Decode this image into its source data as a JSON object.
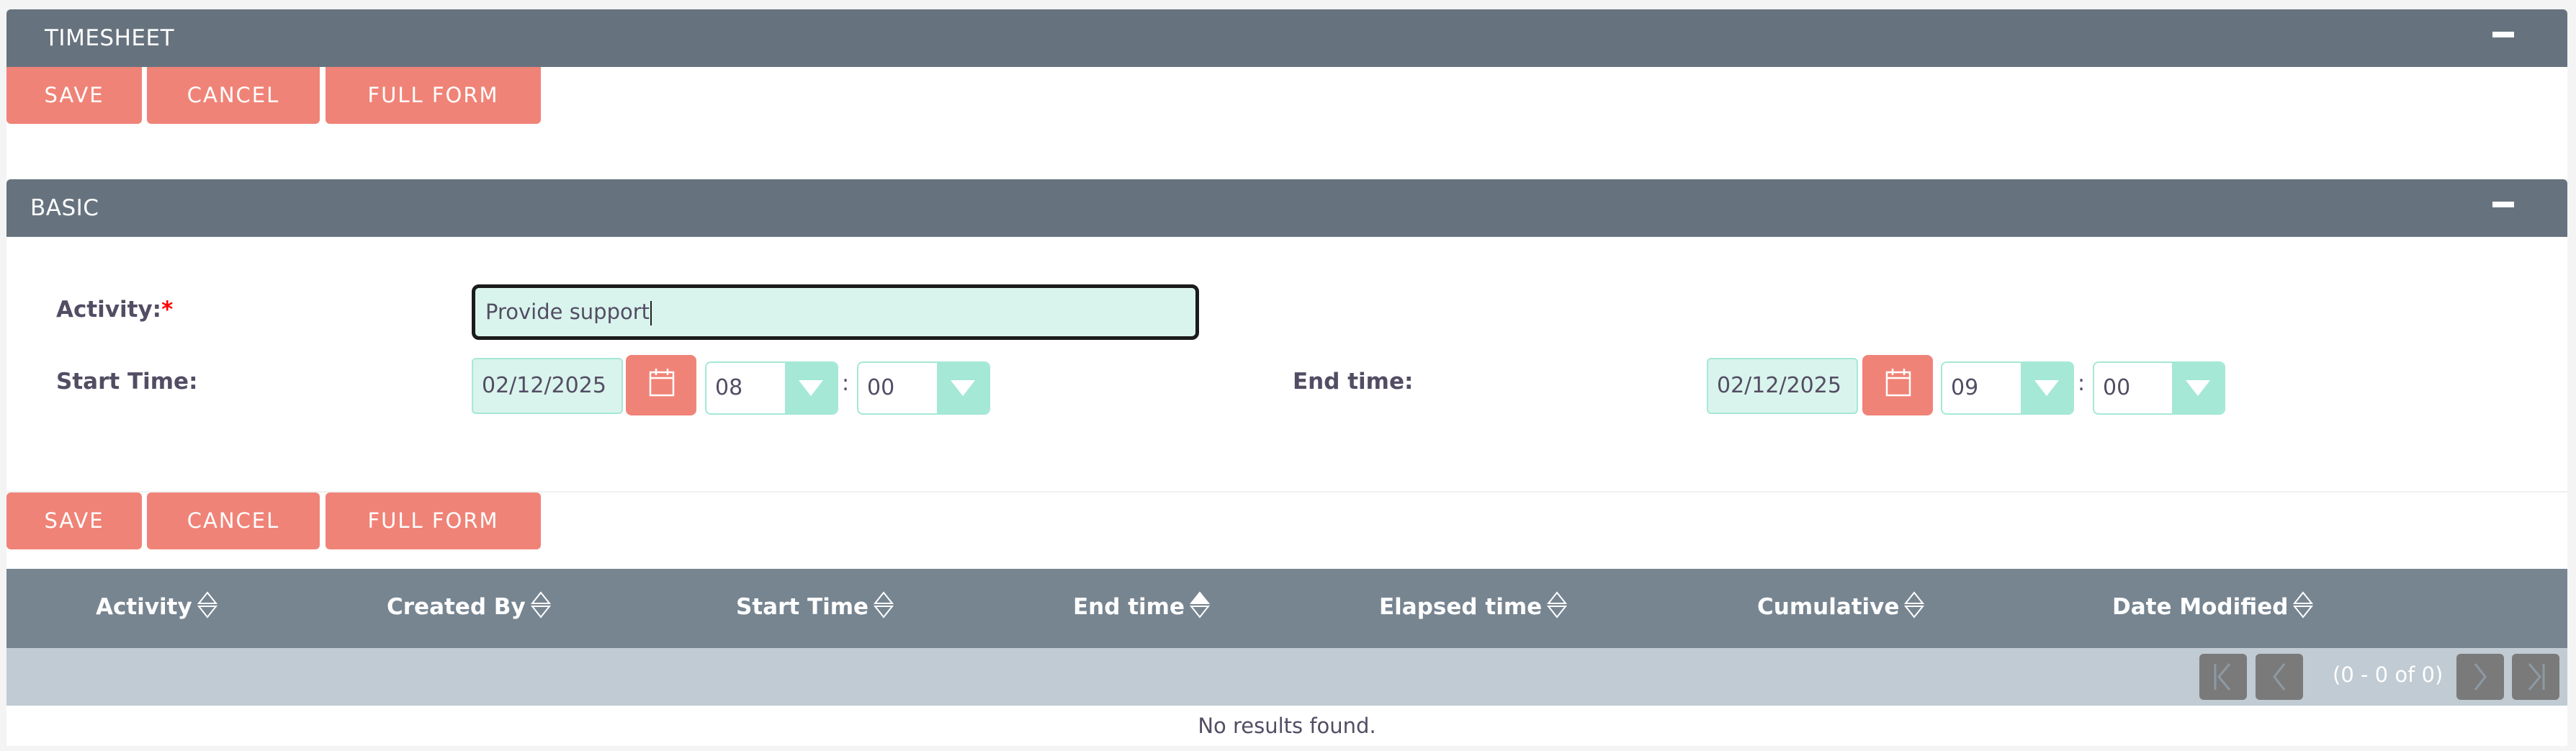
{
  "timesheet_header": {
    "title": "TIMESHEET",
    "collapse_icon": "minus-icon"
  },
  "top_buttons": {
    "save": "SAVE",
    "cancel": "CANCEL",
    "full_form": "FULL FORM"
  },
  "basic_header": {
    "title": "BASIC",
    "collapse_icon": "minus-icon"
  },
  "form": {
    "activity": {
      "label": "Activity:",
      "required_mark": "*",
      "value": "Provide support"
    },
    "start_time": {
      "label": "Start Time:",
      "date": "02/12/2025",
      "hour": "08",
      "minute": "00",
      "separator": ":"
    },
    "end_time": {
      "label": "End time:",
      "date": "02/12/2025",
      "hour": "09",
      "minute": "00",
      "separator": ":"
    }
  },
  "bottom_buttons": {
    "save": "SAVE",
    "cancel": "CANCEL",
    "full_form": "FULL FORM"
  },
  "table": {
    "columns": [
      {
        "label": "Activity",
        "sort": "none"
      },
      {
        "label": "Created By",
        "sort": "none"
      },
      {
        "label": "Start Time",
        "sort": "none"
      },
      {
        "label": "End time",
        "sort": "ascending"
      },
      {
        "label": "Elapsed time",
        "sort": "none"
      },
      {
        "label": "Cumulative",
        "sort": "none"
      },
      {
        "label": "Date Modified",
        "sort": "none"
      }
    ],
    "pagination": {
      "range_text": "(0 - 0 of 0)"
    },
    "empty_message": "No results found."
  },
  "colors": {
    "header_bg": "#66737e",
    "button_bg": "#f08377",
    "input_bg": "#d9f4ec",
    "select_accent": "#a5e8d6",
    "table_header_bg": "#778591",
    "pager_bg": "#c0cbd3"
  }
}
